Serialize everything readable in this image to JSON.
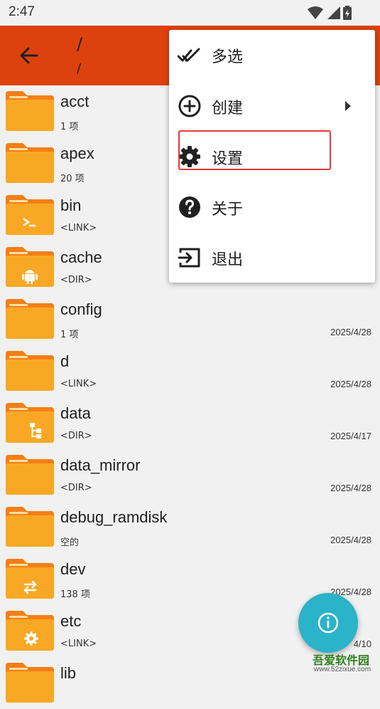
{
  "status_bar": {
    "time": "2:47",
    "icons": [
      "wifi-icon",
      "signal-icon",
      "battery-icon"
    ]
  },
  "toolbar": {
    "back_icon": "arrow-back-icon",
    "path_title": "/",
    "path_sub": "/"
  },
  "colors": {
    "toolbar": "#dd420e",
    "folder": "#f9a825",
    "folder_tab": "#f57f17",
    "fab": "#2bb3c9",
    "highlight": "#e53935"
  },
  "files": [
    {
      "name": "acct",
      "meta": "1 项",
      "date": "",
      "icon": "folder-icon"
    },
    {
      "name": "apex",
      "meta": "20 项",
      "date": "",
      "icon": "folder-icon"
    },
    {
      "name": "bin",
      "meta": "<LINK>",
      "date": "",
      "icon": "terminal-folder-icon"
    },
    {
      "name": "cache",
      "meta": "<DIR>",
      "date": "",
      "icon": "android-folder-icon"
    },
    {
      "name": "config",
      "meta": "1 项",
      "date": "2025/4/28",
      "icon": "folder-icon"
    },
    {
      "name": "d",
      "meta": "<LINK>",
      "date": "2025/4/28",
      "icon": "folder-icon"
    },
    {
      "name": "data",
      "meta": "<DIR>",
      "date": "2025/4/17",
      "icon": "tree-folder-icon"
    },
    {
      "name": "data_mirror",
      "meta": "<DIR>",
      "date": "2025/4/28",
      "icon": "folder-icon"
    },
    {
      "name": "debug_ramdisk",
      "meta": "空的",
      "date": "2025/4/28",
      "icon": "folder-icon"
    },
    {
      "name": "dev",
      "meta": "138 项",
      "date": "2025/4/28",
      "icon": "swap-folder-icon"
    },
    {
      "name": "etc",
      "meta": "<LINK>",
      "date": "4/10",
      "icon": "settings-folder-icon"
    },
    {
      "name": "lib",
      "meta": "",
      "date": "",
      "icon": "folder-icon"
    }
  ],
  "menu": {
    "items": [
      {
        "label": "多选",
        "icon": "double-check-icon"
      },
      {
        "label": "创建",
        "icon": "add-circle-icon"
      },
      {
        "label": "设置",
        "icon": "gear-icon"
      },
      {
        "label": "关于",
        "icon": "help-circle-icon"
      },
      {
        "label": "退出",
        "icon": "exit-icon"
      }
    ]
  },
  "fab": {
    "icon": "info-icon"
  },
  "watermark": {
    "title": "吾爱软件园",
    "url": "www.52zixue.com"
  }
}
